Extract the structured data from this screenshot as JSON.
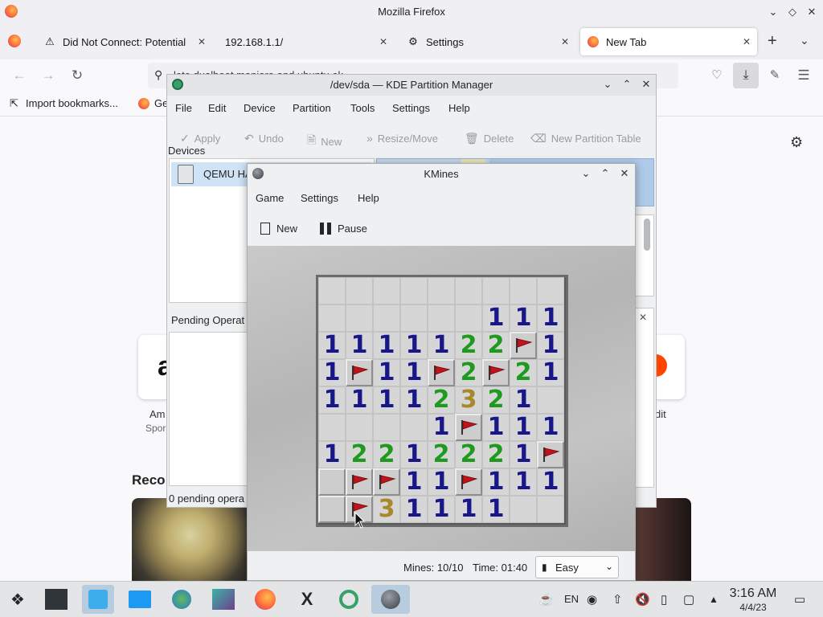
{
  "firefox": {
    "window_title": "Mozilla Firefox",
    "tabs": [
      {
        "label": "Did Not Connect: Potential",
        "icon": "warning-icon"
      },
      {
        "label": "192.168.1.1/",
        "icon": "none"
      },
      {
        "label": "Settings",
        "icon": "gear-icon"
      },
      {
        "label": "New Tab",
        "icon": "firefox-icon"
      }
    ],
    "url_partial": "lete dualboot manjaro and ubuntu ok",
    "bookmarks": [
      {
        "label": "Import bookmarks..."
      },
      {
        "label": "Ge"
      }
    ],
    "content": {
      "recent_heading": "Reco",
      "tile_left_label": "Am",
      "tile_left_sub": "Spor",
      "tile_right_label": "dit"
    }
  },
  "partition_manager": {
    "title": "/dev/sda — KDE Partition Manager",
    "menu": [
      "File",
      "Edit",
      "Device",
      "Partition",
      "Tools",
      "Settings",
      "Help"
    ],
    "toolbar": {
      "apply": "Apply",
      "undo": "Undo",
      "new": "New",
      "resize_move": "Resize/Move",
      "delete": "Delete",
      "new_partition_table": "New Partition Table"
    },
    "devices_label": "Devices",
    "device_name": "QEMU HA",
    "pending_label": "Pending Operat",
    "status": "0 pending opera"
  },
  "kmines": {
    "title": "KMines",
    "menu": [
      "Game",
      "Settings",
      "Help"
    ],
    "toolbar": {
      "new": "New",
      "pause": "Pause"
    },
    "board": [
      [
        "c",
        "c",
        "c",
        "c",
        "c",
        "c",
        "c",
        "c",
        "c"
      ],
      [
        "c",
        "c",
        "c",
        "c",
        "c",
        "c",
        "1",
        "1",
        "1"
      ],
      [
        "1",
        "1",
        "1",
        "1",
        "1",
        "2",
        "2",
        "F",
        "1"
      ],
      [
        "1",
        "F",
        "1",
        "1",
        "F",
        "2",
        "F",
        "2",
        "1"
      ],
      [
        "1",
        "1",
        "1",
        "1",
        "2",
        "3",
        "2",
        "1",
        "c"
      ],
      [
        "c",
        "c",
        "c",
        "c",
        "1",
        "F",
        "1",
        "1",
        "1"
      ],
      [
        "1",
        "2",
        "2",
        "1",
        "2",
        "2",
        "2",
        "1",
        "F"
      ],
      [
        "C",
        "F",
        "F",
        "1",
        "1",
        "F",
        "1",
        "1",
        "1"
      ],
      [
        "C",
        "F",
        "3",
        "1",
        "1",
        "1",
        "1",
        "c",
        "c"
      ]
    ],
    "status": {
      "mines": "Mines: 10/10",
      "time": "Time: 01:40",
      "difficulty": "Easy"
    }
  },
  "taskbar": {
    "lang": "EN",
    "clock_time": "3:16 AM",
    "clock_date": "4/4/23"
  }
}
